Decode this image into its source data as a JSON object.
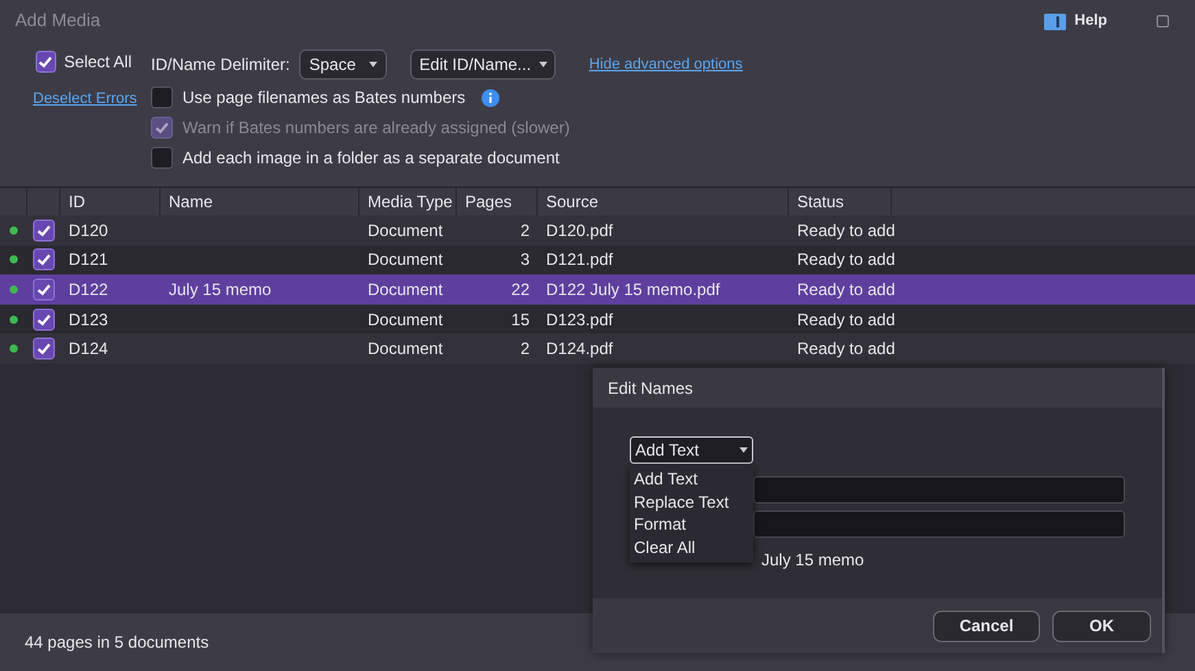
{
  "window": {
    "title": "Add Media",
    "help": "Help"
  },
  "options": {
    "select_all": {
      "label": "Select All",
      "checked": true
    },
    "deselect_errors": "Deselect Errors",
    "delimiter_label": "ID/Name Delimiter:",
    "delimiter_value": "Space",
    "edit_button": "Edit ID/Name...",
    "advanced_link": "Hide advanced options",
    "checkboxes": [
      {
        "label": "Use page filenames as Bates numbers",
        "checked": false,
        "disabled": false,
        "info": true
      },
      {
        "label": "Warn if Bates numbers are already assigned (slower)",
        "checked": true,
        "disabled": true,
        "info": false
      },
      {
        "label": "Add each image in a folder as a separate document",
        "checked": false,
        "disabled": false,
        "info": false
      }
    ]
  },
  "table": {
    "columns": [
      "ID",
      "Name",
      "Media Type",
      "Pages",
      "Source",
      "Status"
    ],
    "rows": [
      {
        "color": "#3fb950",
        "checked": true,
        "selected": false,
        "cells": [
          "D120",
          "",
          "Document",
          "2",
          "D120.pdf",
          "Ready to add"
        ]
      },
      {
        "color": "#3fb950",
        "checked": true,
        "selected": false,
        "cells": [
          "D121",
          "",
          "Document",
          "3",
          "D121.pdf",
          "Ready to add"
        ]
      },
      {
        "color": "#3fb950",
        "checked": true,
        "selected": true,
        "cells": [
          "D122",
          "July 15 memo",
          "Document",
          "22",
          "D122 July 15 memo.pdf",
          "Ready to add"
        ]
      },
      {
        "color": "#3fb950",
        "checked": true,
        "selected": false,
        "cells": [
          "D123",
          "",
          "Document",
          "15",
          "D123.pdf",
          "Ready to add"
        ]
      },
      {
        "color": "#3fb950",
        "checked": true,
        "selected": false,
        "cells": [
          "D124",
          "",
          "Document",
          "2",
          "D124.pdf",
          "Ready to add"
        ]
      }
    ]
  },
  "status_bar": "44 pages in 5 documents",
  "dialog": {
    "title": "Edit Names",
    "action": "Add Text",
    "menu": [
      "Add Text",
      "Replace Text",
      "Format",
      "Clear All"
    ],
    "preview": "July 15 memo",
    "buttons": [
      "Cancel",
      "OK"
    ]
  }
}
